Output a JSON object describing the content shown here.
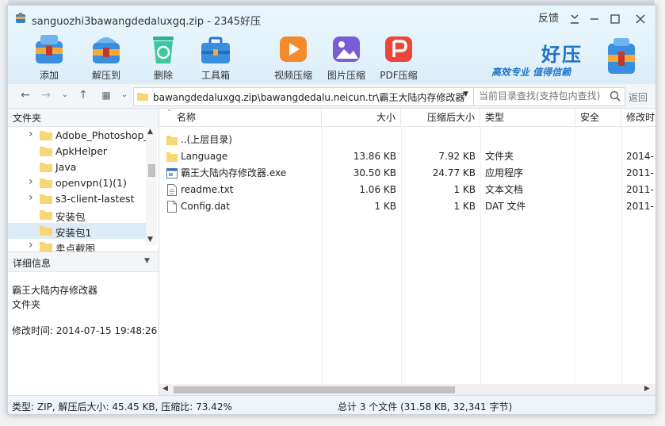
{
  "window": {
    "title": "sanguozhi3bawangdedaluxgq.zip - 2345好压",
    "feedback": "反馈"
  },
  "toolbar": {
    "add_label": "添加",
    "extract_label": "解压到",
    "delete_label": "删除",
    "toolbox_label": "工具箱",
    "video_label": "视频压缩",
    "image_label": "图片压缩",
    "pdf_label": "PDF压缩"
  },
  "brand": {
    "name": "好压",
    "slogan": "高效专业 值得信赖"
  },
  "address": {
    "path": "bawangdedaluxgq.zip\\bawangdedalu.neicun.tr\\霸王大陆内存修改器",
    "search_placeholder": "当前目录查找(支持包内查找)",
    "return_label": "返回"
  },
  "tree": {
    "header": "文件夹",
    "items": [
      {
        "label": "Adobe_Photoshop_",
        "expandable": true
      },
      {
        "label": "ApkHelper",
        "expandable": false
      },
      {
        "label": "Java",
        "expandable": false
      },
      {
        "label": "openvpn(1)(1)",
        "expandable": true
      },
      {
        "label": "s3-client-lastest",
        "expandable": true
      },
      {
        "label": "安装包",
        "expandable": false
      },
      {
        "label": "安装包1",
        "expandable": false
      },
      {
        "label": "卖点截图",
        "expandable": true
      }
    ]
  },
  "details": {
    "header": "详细信息",
    "name": "霸王大陆内存修改器",
    "kind": "文件夹",
    "modified": "修改时间: 2014-07-15 19:48:26"
  },
  "columns": {
    "name": "名称",
    "size": "大小",
    "csize": "压缩后大小",
    "type": "类型",
    "security": "安全",
    "mtime": "修改时"
  },
  "files": [
    {
      "name": "..(上层目录)",
      "size": "",
      "csize": "",
      "type": "",
      "mtime": "",
      "icon": "folder-icon"
    },
    {
      "name": "Language",
      "size": "13.86 KB",
      "csize": "7.92 KB",
      "type": "文件夹",
      "mtime": "2014-",
      "icon": "folder-icon"
    },
    {
      "name": "霸王大陆内存修改器.exe",
      "size": "30.50 KB",
      "csize": "24.77 KB",
      "type": "应用程序",
      "mtime": "2011-",
      "icon": "exe-icon"
    },
    {
      "name": "readme.txt",
      "size": "1.06 KB",
      "csize": "1 KB",
      "type": "文本文档",
      "mtime": "2011-",
      "icon": "text-file-icon"
    },
    {
      "name": "Config.dat",
      "size": "1 KB",
      "csize": "1 KB",
      "type": "DAT 文件",
      "mtime": "2011-",
      "icon": "file-icon"
    }
  ],
  "status": {
    "left": "类型: ZIP, 解压后大小: 45.45 KB, 压缩比: 73.42%",
    "right": "总计 3 个文件 (31.58 KB, 32,341 字节)"
  },
  "colors": {
    "brand_blue": "#1e73c8",
    "selection": "#ddebf7",
    "folder_yellow": "#f7d774"
  }
}
